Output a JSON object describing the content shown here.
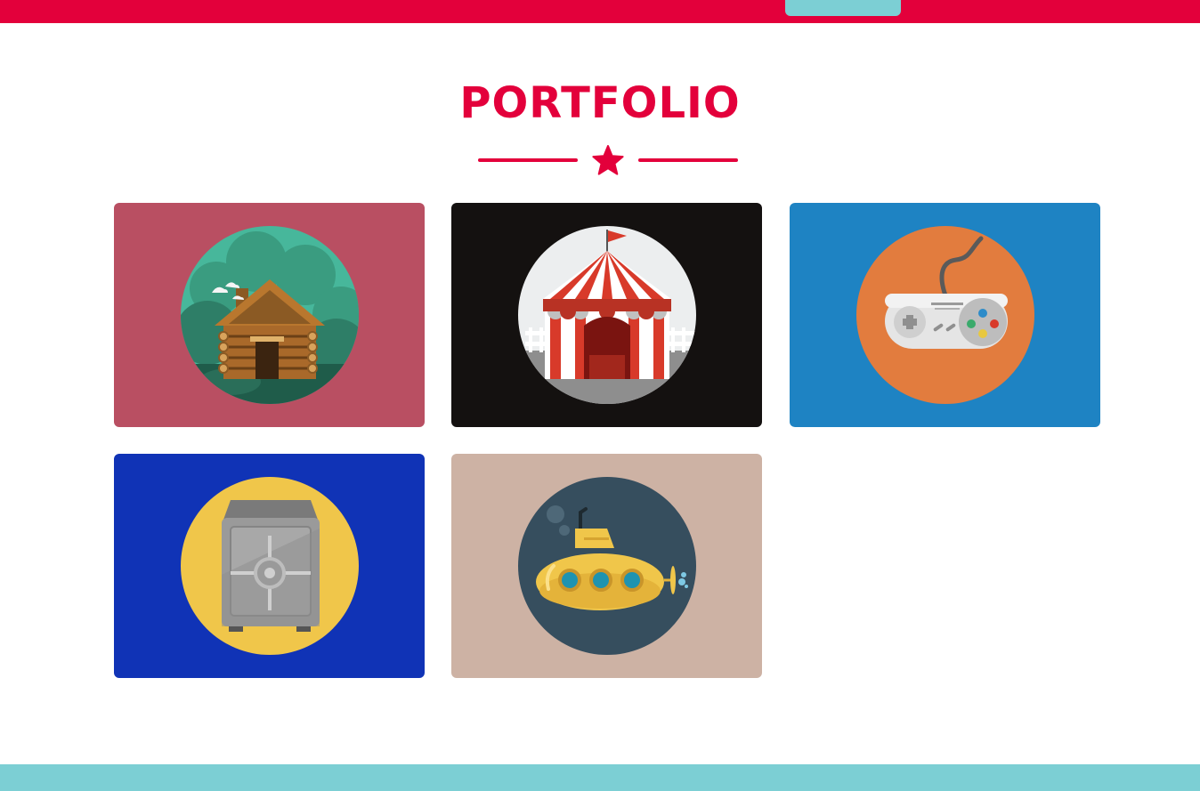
{
  "header": {
    "accent_color": "#e3003b",
    "tab_color": "#7ccfd4"
  },
  "section": {
    "title": "PORTFOLIO",
    "divider_icon": "star-icon"
  },
  "portfolio": {
    "items": [
      {
        "icon": "log-cabin-icon",
        "background": "#b94f62",
        "circle": "#47b79b"
      },
      {
        "icon": "circus-tent-icon",
        "background": "#141110",
        "circle": "#eceeef"
      },
      {
        "icon": "game-controller-icon",
        "background": "#1e83c3",
        "circle": "#e27c3e"
      },
      {
        "icon": "safe-icon",
        "background": "#1033b6",
        "circle": "#f0c64a"
      },
      {
        "icon": "submarine-icon",
        "background": "#cdb2a4",
        "circle": "#364e5e"
      }
    ]
  },
  "footer": {
    "color": "#7ccfd4"
  }
}
